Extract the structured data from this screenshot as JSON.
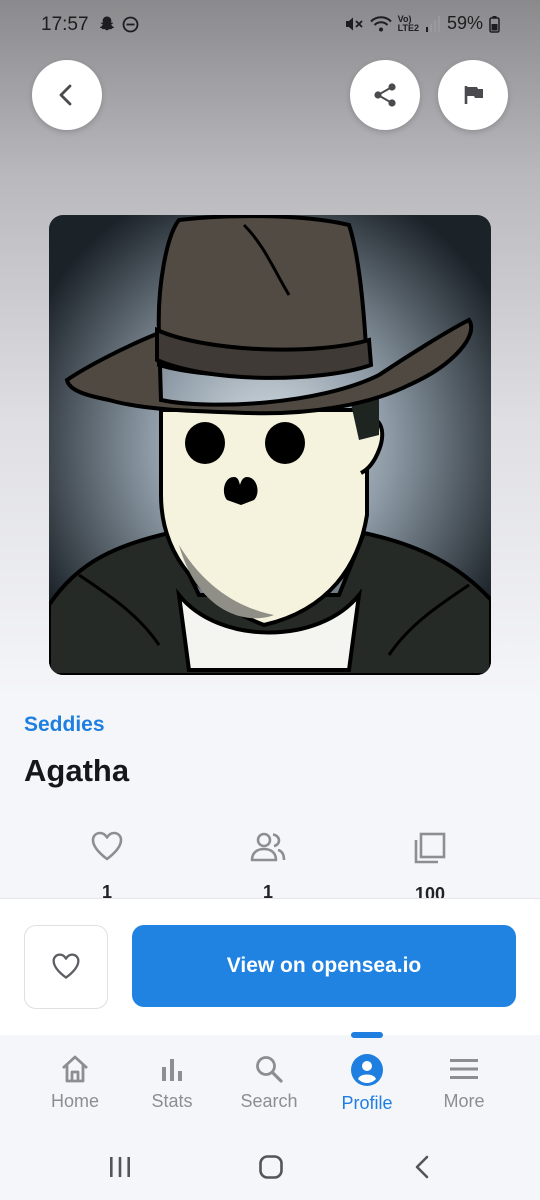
{
  "status_bar": {
    "time": "17:57",
    "battery": "59%",
    "network_label_top": "Vo)",
    "network_label_bottom": "LTE2"
  },
  "header": {
    "back_icon": "chevron-left-icon",
    "share_icon": "share-icon",
    "flag_icon": "flag-icon"
  },
  "nft": {
    "collection": "Seddies",
    "name": "Agatha",
    "image_desc_icon": "skull-hat-artwork"
  },
  "stats": {
    "favorites": "1",
    "owners": "1",
    "items": "100"
  },
  "actions": {
    "view_label": "View on opensea.io"
  },
  "bottom_nav": {
    "items": [
      {
        "label": "Home",
        "icon": "home-icon"
      },
      {
        "label": "Stats",
        "icon": "bar-chart-icon"
      },
      {
        "label": "Search",
        "icon": "search-icon"
      },
      {
        "label": "Profile",
        "icon": "profile-icon"
      },
      {
        "label": "More",
        "icon": "menu-icon"
      }
    ],
    "active": "Profile"
  },
  "colors": {
    "accent": "#1f7fe0",
    "button": "#2083e2",
    "inactive": "#8c8e93"
  }
}
